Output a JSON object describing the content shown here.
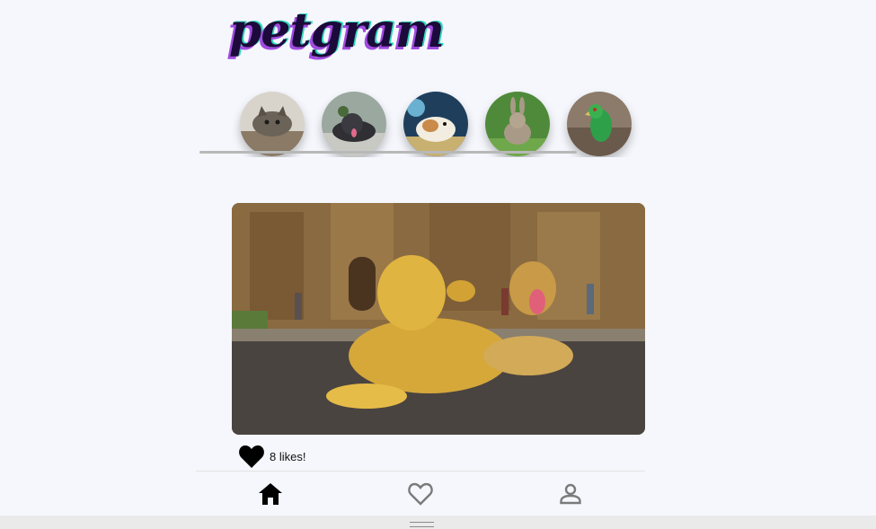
{
  "app": {
    "logo_text": "petgram"
  },
  "stories": [
    {
      "name": "cat",
      "icon": "cat-icon"
    },
    {
      "name": "dog",
      "icon": "dog-icon"
    },
    {
      "name": "hamster",
      "icon": "hamster-icon"
    },
    {
      "name": "rabbit",
      "icon": "rabbit-icon"
    },
    {
      "name": "bird",
      "icon": "bird-icon"
    }
  ],
  "post": {
    "likes_text": "8 likes!",
    "liked": true
  },
  "nav": {
    "items": [
      "home",
      "favorites",
      "user"
    ],
    "active": "home"
  },
  "colors": {
    "background": "#f5f7fc",
    "logo_main": "#1c0a3a",
    "logo_shadow_purple": "#a14be0",
    "logo_shadow_teal": "#2ad6b8"
  }
}
